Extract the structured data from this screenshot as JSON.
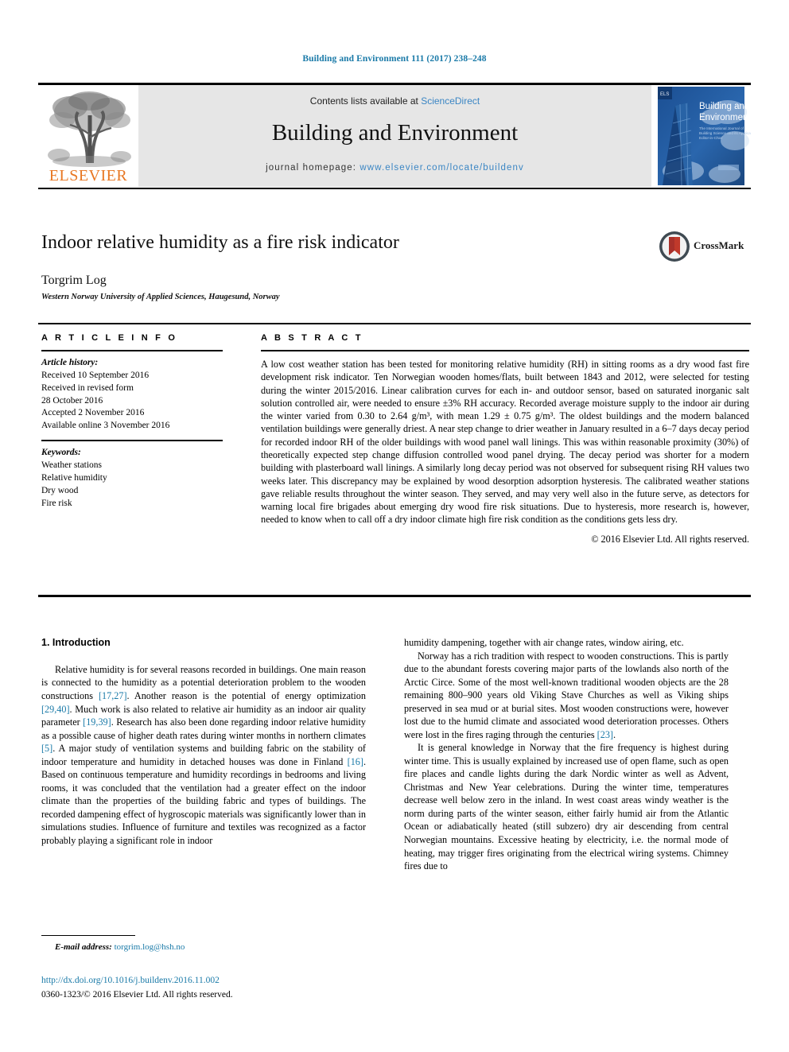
{
  "running_head": "Building and Environment 111 (2017) 238–248",
  "masthead": {
    "publisher_name": "ELSEVIER",
    "contents_prefix": "Contents lists available at ",
    "contents_link": "ScienceDirect",
    "journal_title": "Building and Environment",
    "homepage_prefix": "journal homepage: ",
    "homepage_url": "www.elsevier.com/locate/buildenv",
    "cover_title_line1": "Building and",
    "cover_title_line2": "Environment"
  },
  "article": {
    "title": "Indoor relative humidity as a fire risk indicator",
    "author": "Torgrim Log",
    "affiliation": "Western Norway University of Applied Sciences, Haugesund, Norway",
    "crossmark_label": "CrossMark"
  },
  "article_info": {
    "heading": "A R T I C L E   I N F O",
    "history_label": "Article history:",
    "history": [
      "Received 10 September 2016",
      "Received in revised form",
      "28 October 2016",
      "Accepted 2 November 2016",
      "Available online 3 November 2016"
    ],
    "keywords_label": "Keywords:",
    "keywords": [
      "Weather stations",
      "Relative humidity",
      "Dry wood",
      "Fire risk"
    ]
  },
  "abstract": {
    "heading": "A B S T R A C T",
    "text": "A low cost weather station has been tested for monitoring relative humidity (RH) in sitting rooms as a dry wood fast fire development risk indicator. Ten Norwegian wooden homes/flats, built between 1843 and 2012, were selected for testing during the winter 2015/2016. Linear calibration curves for each in- and outdoor sensor, based on saturated inorganic salt solution controlled air, were needed to ensure ±3% RH accuracy. Recorded average moisture supply to the indoor air during the winter varied from 0.30 to 2.64 g/m³, with mean 1.29 ± 0.75 g/m³. The oldest buildings and the modern balanced ventilation buildings were generally driest. A near step change to drier weather in January resulted in a 6–7 days decay period for recorded indoor RH of the older buildings with wood panel wall linings. This was within reasonable proximity (30%) of theoretically expected step change diffusion controlled wood panel drying. The decay period was shorter for a modern building with plasterboard wall linings. A similarly long decay period was not observed for subsequent rising RH values two weeks later. This discrepancy may be explained by wood desorption adsorption hysteresis. The calibrated weather stations gave reliable results throughout the winter season. They served, and may very well also in the future serve, as detectors for warning local fire brigades about emerging dry wood fire risk situations. Due to hysteresis, more research is, however, needed to know when to call off a dry indoor climate high fire risk condition as the conditions gets less dry.",
    "copyright": "© 2016 Elsevier Ltd. All rights reserved."
  },
  "introduction": {
    "section_title": "1. Introduction",
    "left_paragraph_html": "Relative humidity is for several reasons recorded in buildings. One main reason is connected to the humidity as a potential deterioration problem to the wooden constructions <span class=\"cite\">[17,27]</span>. Another reason is the potential of energy optimization <span class=\"cite\">[29,40]</span>. Much work is also related to relative air humidity as an indoor air quality parameter <span class=\"cite\">[19,39]</span>. Research has also been done regarding indoor relative humidity as a possible cause of higher death rates during winter months in northern climates <span class=\"cite\">[5]</span>. A major study of ventilation systems and building fabric on the stability of indoor temperature and humidity in detached houses was done in Finland <span class=\"cite\">[16]</span>. Based on continuous temperature and humidity recordings in bedrooms and living rooms, it was concluded that the ventilation had a greater effect on the indoor climate than the properties of the building fabric and types of buildings. The recorded dampening effect of hygroscopic materials was significantly lower than in simulations studies. Influence of furniture and textiles was recognized as a factor probably playing a significant role in indoor",
    "right_paragraph1_html": "humidity dampening, together with air change rates, window airing, etc.",
    "right_paragraph2_html": "Norway has a rich tradition with respect to wooden constructions. This is partly due to the abundant forests covering major parts of the lowlands also north of the Arctic Circe. Some of the most well-known traditional wooden objects are the 28 remaining 800–900 years old Viking Stave Churches as well as Viking ships preserved in sea mud or at burial sites. Most wooden constructions were, however lost due to the humid climate and associated wood deterioration processes. Others were lost in the fires raging through the centuries <span class=\"cite\">[23]</span>.",
    "right_paragraph3_html": "It is general knowledge in Norway that the fire frequency is highest during winter time. This is usually explained by increased use of open flame, such as open fire places and candle lights during the dark Nordic winter as well as Advent, Christmas and New Year celebrations. During the winter time, temperatures decrease well below zero in the inland. In west coast areas windy weather is the norm during parts of the winter season, either fairly humid air from the Atlantic Ocean or adiabatically heated (still subzero) dry air descending from central Norwegian mountains. Excessive heating by electricity, i.e. the normal mode of heating, may trigger fires originating from the electrical wiring systems. Chimney fires due to"
  },
  "footer": {
    "email_label": "E-mail address:",
    "email": "torgrim.log@hsh.no",
    "doi": "http://dx.doi.org/10.1016/j.buildenv.2016.11.002",
    "issn": "0360-1323/© 2016 Elsevier Ltd. All rights reserved."
  },
  "colors": {
    "link_blue": "#1a7aa8",
    "sciencedirect_blue": "#3b86c4",
    "elsevier_orange": "#E87722",
    "band_gray": "#e6e6e6"
  }
}
